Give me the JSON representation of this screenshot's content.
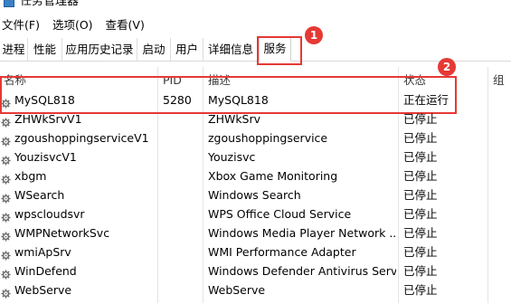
{
  "window": {
    "title": "任务管理器"
  },
  "menu": [
    "文件(F)",
    "选项(O)",
    "查看(V)"
  ],
  "tabs": [
    "进程",
    "性能",
    "应用历史记录",
    "启动",
    "用户",
    "详细信息",
    "服务"
  ],
  "active_tab": "服务",
  "columns": {
    "name": "名称",
    "pid": "PID",
    "description": "描述",
    "status": "状态",
    "group": "组"
  },
  "annotations": [
    "1",
    "2"
  ],
  "services": [
    {
      "name": "MySQL818",
      "pid": "5280",
      "description": "MySQL818",
      "status": "正在运行"
    },
    {
      "name": "ZHWkSrvV1",
      "pid": "",
      "description": "ZHWkSrv",
      "status": "已停止"
    },
    {
      "name": "zgoushoppingserviceV1",
      "pid": "",
      "description": "zgoushoppingservice",
      "status": "已停止"
    },
    {
      "name": "YouzisvcV1",
      "pid": "",
      "description": "Youzisvc",
      "status": "已停止"
    },
    {
      "name": "xbgm",
      "pid": "",
      "description": "Xbox Game Monitoring",
      "status": "已停止"
    },
    {
      "name": "WSearch",
      "pid": "",
      "description": "Windows Search",
      "status": "已停止"
    },
    {
      "name": "wpscloudsvr",
      "pid": "",
      "description": "WPS Office Cloud Service",
      "status": "已停止"
    },
    {
      "name": "WMPNetworkSvc",
      "pid": "",
      "description": "Windows Media Player Network ...",
      "status": "已停止"
    },
    {
      "name": "wmiApSrv",
      "pid": "",
      "description": "WMI Performance Adapter",
      "status": "已停止"
    },
    {
      "name": "WinDefend",
      "pid": "",
      "description": "Windows Defender Antivirus Serv...",
      "status": "已停止"
    },
    {
      "name": "WebServe",
      "pid": "",
      "description": "WebServe",
      "status": "已停止"
    }
  ],
  "colors": {
    "annotation": "#e53935",
    "gear": "#6b6b6b"
  },
  "icons": {
    "service_row": "gear-icon",
    "app": "task-manager-icon"
  }
}
